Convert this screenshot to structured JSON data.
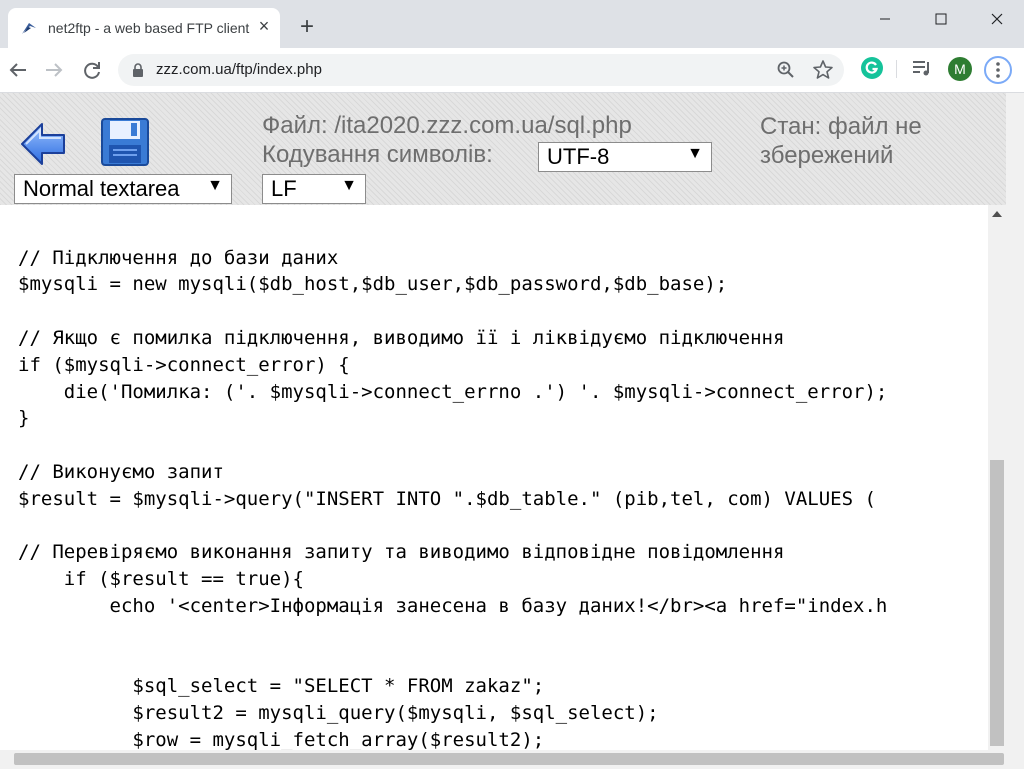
{
  "browser": {
    "tab_title": "net2ftp - a web based FTP client",
    "url": "zzz.com.ua/ftp/index.php",
    "profile_initial": "M",
    "icons": [
      "back-arrow-icon",
      "forward-arrow-icon",
      "reload-icon",
      "lock-icon",
      "zoom-icon",
      "star-icon",
      "grammarly-icon",
      "media-control-icon",
      "menu-icon"
    ]
  },
  "header": {
    "file_label": "Файл: /ita2020.zzz.com.ua/sql.php",
    "encoding_label": "Кодування символів:",
    "encoding_value": "UTF-8",
    "status": "Стан: файл не збережений",
    "textarea_mode": "Normal textarea",
    "line_ending": "LF"
  },
  "editor": {
    "lines": [
      "",
      "",
      "// Підключення до бази даних",
      "$mysqli = new mysqli($db_host,$db_user,$db_password,$db_base);",
      "",
      "// Якщо є помилка підключення, виводимо її і ліквідуємо підключення",
      "if ($mysqli->connect_error) {",
      "    die('Помилка: ('. $mysqli->connect_errno .') '. $mysqli->connect_error);",
      "}",
      "",
      "// Виконуємо запит",
      "$result = $mysqli->query(\"INSERT INTO \".$db_table.\" (pib,tel, com) VALUES (",
      "",
      "// Перевіряємо виконання запиту та виводимо відповідне повідомлення",
      "    if ($result == true){",
      "        echo '<center>Інформація занесена в базу даних!</br><a href=\"index.h",
      "",
      "",
      "          $sql_select = \"SELECT * FROM zakaz\";",
      "          $result2 = mysqli_query($mysqli, $sql_select);",
      "          $row = mysqli_fetch_array($result2);"
    ]
  },
  "colors": {
    "accent_blue": "#1a73e8",
    "header_bg": "#e6e6e6",
    "label_gray": "#6e6e6e"
  }
}
